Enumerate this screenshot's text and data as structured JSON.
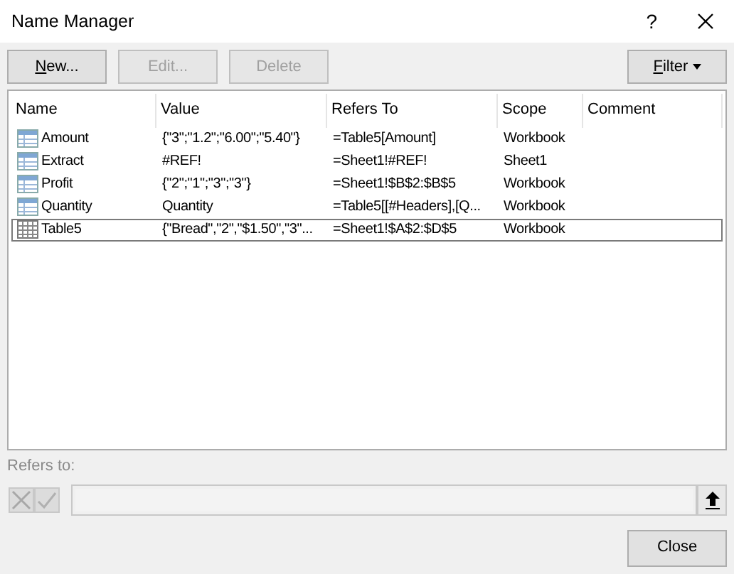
{
  "window": {
    "title": "Name Manager",
    "help": "?"
  },
  "toolbar": [
    {
      "label": "New...",
      "disabled": false,
      "mnemonic": true
    },
    {
      "label": "Edit...",
      "disabled": true,
      "mnemonic": false
    },
    {
      "label": "Delete",
      "disabled": true,
      "mnemonic": false
    }
  ],
  "filter": {
    "label": "Filter",
    "mnemonic": true
  },
  "table": {
    "columns": [
      "Name",
      "Value",
      "Refers To",
      "Scope",
      "Comment"
    ],
    "rows": [
      {
        "kind": "range",
        "name": "Amount",
        "value": "{\"3\";\"1.2\";\"6.00\";\"5.40\"}",
        "refers_to": "=Table5[Amount]",
        "scope": "Workbook",
        "selected": false
      },
      {
        "kind": "range",
        "name": "Extract",
        "value": "#REF!",
        "refers_to": "=Sheet1!#REF!",
        "scope": "Sheet1",
        "selected": false
      },
      {
        "kind": "range",
        "name": "Profit",
        "value": "{\"2\";\"1\";\"3\";\"3\"}",
        "refers_to": "=Sheet1!$B$2:$B$5",
        "scope": "Workbook",
        "selected": false
      },
      {
        "kind": "range",
        "name": "Quantity",
        "value": "Quantity",
        "refers_to": "=Table5[[#Headers],[Q...",
        "scope": "Workbook",
        "selected": false
      },
      {
        "kind": "table",
        "name": "Table5",
        "value": "{\"Bread\",\"2\",\"$1.50\",\"3\"...",
        "refers_to": "=Sheet1!$A$2:$D$5",
        "scope": "Workbook",
        "selected": true
      }
    ]
  },
  "refers_to": {
    "label": "Refers to:",
    "disabled": true
  },
  "buttons": [
    {
      "label": "Close"
    }
  ]
}
